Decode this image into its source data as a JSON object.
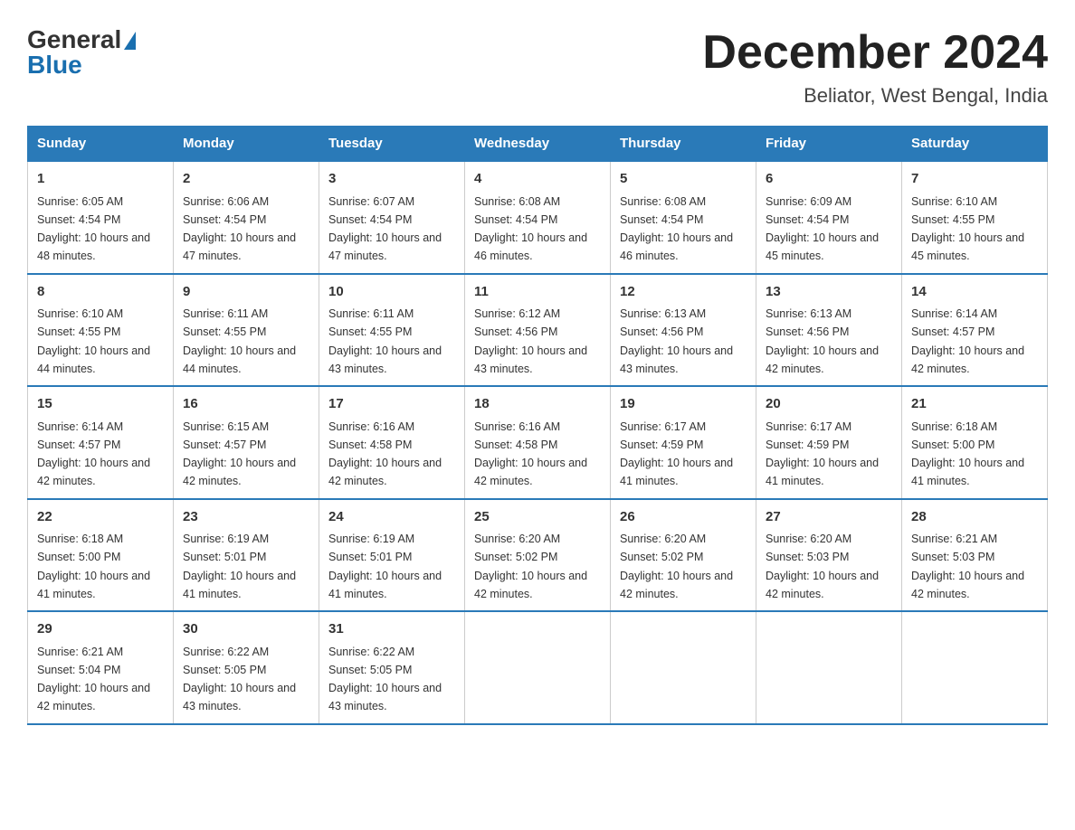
{
  "header": {
    "logo": {
      "general": "General",
      "triangle": "",
      "blue": "Blue"
    },
    "title": "December 2024",
    "subtitle": "Beliator, West Bengal, India"
  },
  "days": [
    "Sunday",
    "Monday",
    "Tuesday",
    "Wednesday",
    "Thursday",
    "Friday",
    "Saturday"
  ],
  "weeks": [
    [
      {
        "num": "1",
        "sunrise": "6:05 AM",
        "sunset": "4:54 PM",
        "daylight": "10 hours and 48 minutes."
      },
      {
        "num": "2",
        "sunrise": "6:06 AM",
        "sunset": "4:54 PM",
        "daylight": "10 hours and 47 minutes."
      },
      {
        "num": "3",
        "sunrise": "6:07 AM",
        "sunset": "4:54 PM",
        "daylight": "10 hours and 47 minutes."
      },
      {
        "num": "4",
        "sunrise": "6:08 AM",
        "sunset": "4:54 PM",
        "daylight": "10 hours and 46 minutes."
      },
      {
        "num": "5",
        "sunrise": "6:08 AM",
        "sunset": "4:54 PM",
        "daylight": "10 hours and 46 minutes."
      },
      {
        "num": "6",
        "sunrise": "6:09 AM",
        "sunset": "4:54 PM",
        "daylight": "10 hours and 45 minutes."
      },
      {
        "num": "7",
        "sunrise": "6:10 AM",
        "sunset": "4:55 PM",
        "daylight": "10 hours and 45 minutes."
      }
    ],
    [
      {
        "num": "8",
        "sunrise": "6:10 AM",
        "sunset": "4:55 PM",
        "daylight": "10 hours and 44 minutes."
      },
      {
        "num": "9",
        "sunrise": "6:11 AM",
        "sunset": "4:55 PM",
        "daylight": "10 hours and 44 minutes."
      },
      {
        "num": "10",
        "sunrise": "6:11 AM",
        "sunset": "4:55 PM",
        "daylight": "10 hours and 43 minutes."
      },
      {
        "num": "11",
        "sunrise": "6:12 AM",
        "sunset": "4:56 PM",
        "daylight": "10 hours and 43 minutes."
      },
      {
        "num": "12",
        "sunrise": "6:13 AM",
        "sunset": "4:56 PM",
        "daylight": "10 hours and 43 minutes."
      },
      {
        "num": "13",
        "sunrise": "6:13 AM",
        "sunset": "4:56 PM",
        "daylight": "10 hours and 42 minutes."
      },
      {
        "num": "14",
        "sunrise": "6:14 AM",
        "sunset": "4:57 PM",
        "daylight": "10 hours and 42 minutes."
      }
    ],
    [
      {
        "num": "15",
        "sunrise": "6:14 AM",
        "sunset": "4:57 PM",
        "daylight": "10 hours and 42 minutes."
      },
      {
        "num": "16",
        "sunrise": "6:15 AM",
        "sunset": "4:57 PM",
        "daylight": "10 hours and 42 minutes."
      },
      {
        "num": "17",
        "sunrise": "6:16 AM",
        "sunset": "4:58 PM",
        "daylight": "10 hours and 42 minutes."
      },
      {
        "num": "18",
        "sunrise": "6:16 AM",
        "sunset": "4:58 PM",
        "daylight": "10 hours and 42 minutes."
      },
      {
        "num": "19",
        "sunrise": "6:17 AM",
        "sunset": "4:59 PM",
        "daylight": "10 hours and 41 minutes."
      },
      {
        "num": "20",
        "sunrise": "6:17 AM",
        "sunset": "4:59 PM",
        "daylight": "10 hours and 41 minutes."
      },
      {
        "num": "21",
        "sunrise": "6:18 AM",
        "sunset": "5:00 PM",
        "daylight": "10 hours and 41 minutes."
      }
    ],
    [
      {
        "num": "22",
        "sunrise": "6:18 AM",
        "sunset": "5:00 PM",
        "daylight": "10 hours and 41 minutes."
      },
      {
        "num": "23",
        "sunrise": "6:19 AM",
        "sunset": "5:01 PM",
        "daylight": "10 hours and 41 minutes."
      },
      {
        "num": "24",
        "sunrise": "6:19 AM",
        "sunset": "5:01 PM",
        "daylight": "10 hours and 41 minutes."
      },
      {
        "num": "25",
        "sunrise": "6:20 AM",
        "sunset": "5:02 PM",
        "daylight": "10 hours and 42 minutes."
      },
      {
        "num": "26",
        "sunrise": "6:20 AM",
        "sunset": "5:02 PM",
        "daylight": "10 hours and 42 minutes."
      },
      {
        "num": "27",
        "sunrise": "6:20 AM",
        "sunset": "5:03 PM",
        "daylight": "10 hours and 42 minutes."
      },
      {
        "num": "28",
        "sunrise": "6:21 AM",
        "sunset": "5:03 PM",
        "daylight": "10 hours and 42 minutes."
      }
    ],
    [
      {
        "num": "29",
        "sunrise": "6:21 AM",
        "sunset": "5:04 PM",
        "daylight": "10 hours and 42 minutes."
      },
      {
        "num": "30",
        "sunrise": "6:22 AM",
        "sunset": "5:05 PM",
        "daylight": "10 hours and 43 minutes."
      },
      {
        "num": "31",
        "sunrise": "6:22 AM",
        "sunset": "5:05 PM",
        "daylight": "10 hours and 43 minutes."
      },
      null,
      null,
      null,
      null
    ]
  ],
  "labels": {
    "sunrise": "Sunrise:",
    "sunset": "Sunset:",
    "daylight": "Daylight:"
  }
}
